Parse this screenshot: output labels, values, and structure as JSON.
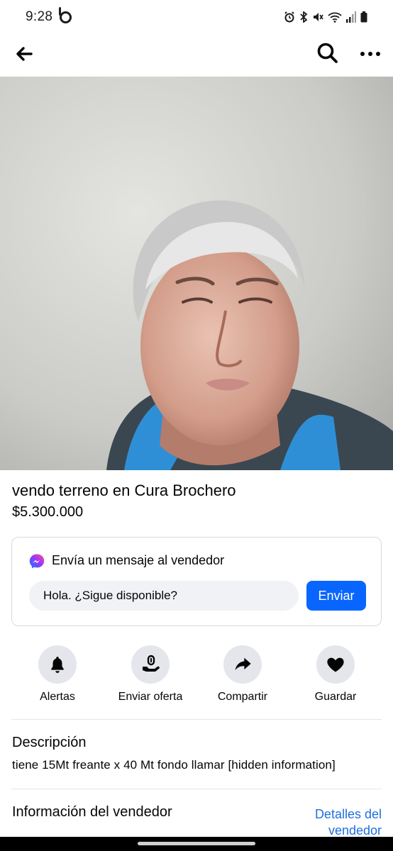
{
  "status_bar": {
    "time": "9:28",
    "icons": [
      "alarm-icon",
      "bluetooth-icon",
      "mute-icon",
      "wifi-icon",
      "signal-icon",
      "battery-icon"
    ]
  },
  "app_bar": {
    "icons": [
      "back-arrow-icon",
      "search-icon",
      "more-options-icon"
    ]
  },
  "listing": {
    "title": "vendo terreno en Cura Brochero",
    "price": "$5.300.000"
  },
  "message_card": {
    "heading": "Envía un mensaje al vendedor",
    "input_value": "Hola. ¿Sigue disponible?",
    "send_label": "Enviar"
  },
  "actions": [
    {
      "label": "Alertas",
      "icon": "bell-icon"
    },
    {
      "label": "Enviar oferta",
      "icon": "offer-icon"
    },
    {
      "label": "Compartir",
      "icon": "share-icon"
    },
    {
      "label": "Guardar",
      "icon": "heart-icon"
    }
  ],
  "description": {
    "title": "Descripción",
    "text": "tiene 15Mt freante x 40 Mt fondo llamar [hidden information]"
  },
  "seller": {
    "title": "Información del vendedor",
    "details_link": "Detalles del vendedor"
  },
  "colors": {
    "accent": "#0866ff",
    "link": "#216fdb",
    "action_circle": "#e4e6eb",
    "input_bg": "#f0f2f5"
  }
}
